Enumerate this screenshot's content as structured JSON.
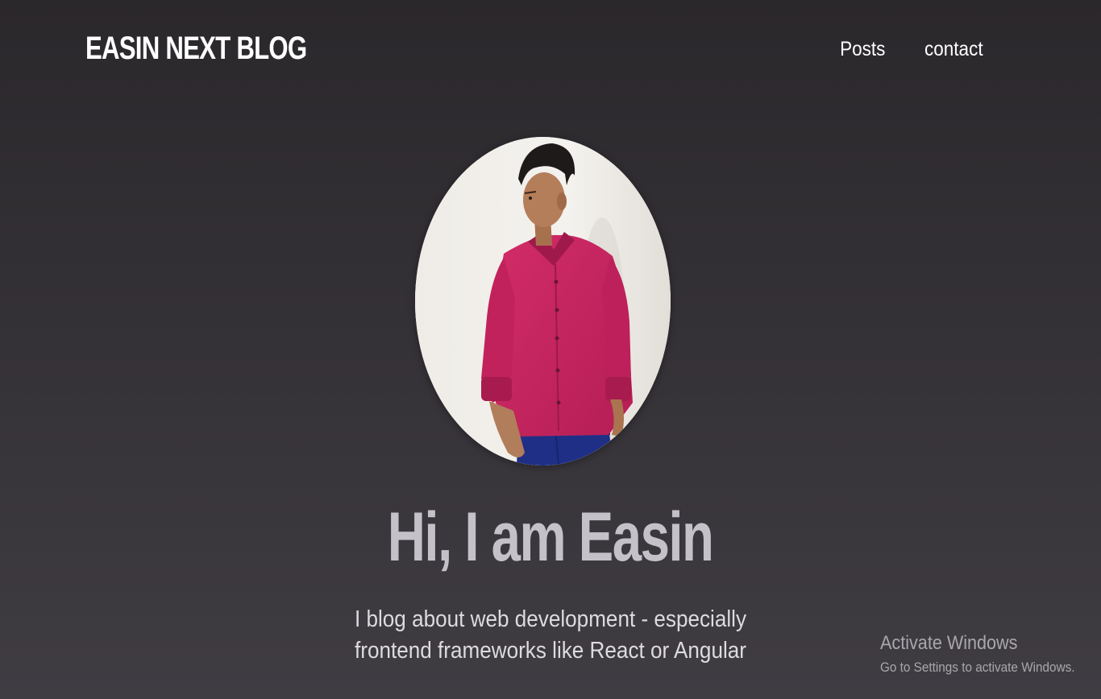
{
  "header": {
    "logo": "EASIN NEXT BLOG",
    "nav": [
      {
        "label": "Posts"
      },
      {
        "label": "contact"
      }
    ]
  },
  "hero": {
    "title": "Hi, I am Easin",
    "subtitle": "I blog about web development - especially frontend frameworks like React or Angular",
    "avatar_icon": "profile-photo"
  },
  "watermark": {
    "title": "Activate Windows",
    "subtitle": "Go to Settings to activate Windows."
  },
  "colors": {
    "background_top": "#2b282c",
    "background_bottom": "#3f3c42",
    "title_text": "#c4c1c8",
    "shirt": "#c8245f"
  }
}
